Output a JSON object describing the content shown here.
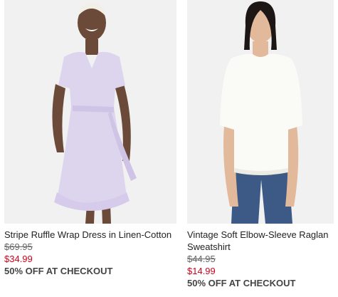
{
  "products": [
    {
      "name": "Stripe Ruffle Wrap Dress in Linen-Cotton",
      "original_price": "$69.95",
      "sale_price": "$34.99",
      "promo": "50% OFF AT CHECKOUT",
      "image": "woman-lavender-wrap-dress-photo"
    },
    {
      "name": "Vintage Soft Elbow-Sleeve Raglan Sweatshirt",
      "original_price": "$44.95",
      "sale_price": "$14.99",
      "promo": "50% OFF AT CHECKOUT",
      "image": "woman-white-sweatshirt-jeans-photo"
    }
  ],
  "colors": {
    "sale": "#d0021b",
    "image_bg": "#f1f1f1"
  }
}
